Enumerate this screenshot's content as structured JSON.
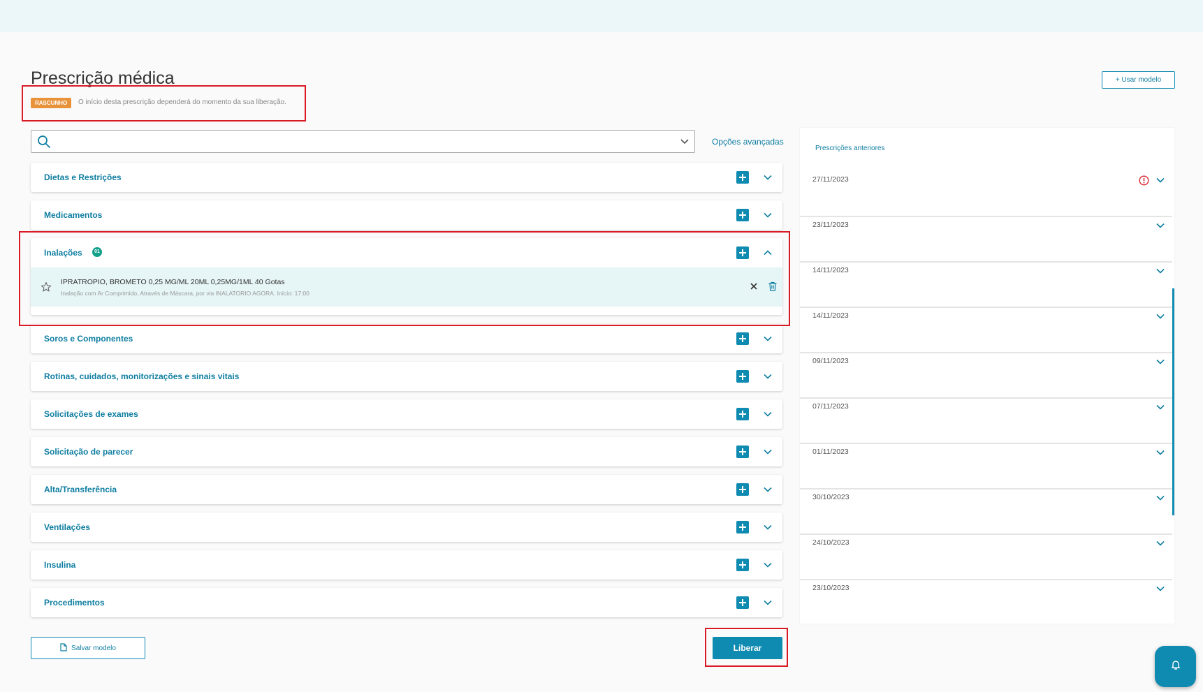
{
  "header": {
    "title": "Prescrição médica",
    "status_badge": "RASCUNHO",
    "status_message": "O início desta prescrição dependerá do momento da sua liberação.",
    "use_model_label": "+ Usar modelo"
  },
  "search": {
    "value": "",
    "placeholder": ""
  },
  "advanced_options_label": "Opções avançadas",
  "sections": [
    {
      "label": "Dietas e Restrições"
    },
    {
      "label": "Medicamentos"
    },
    {
      "label": "Inalações",
      "count": "01",
      "expanded": true,
      "items": [
        {
          "name": "IPRATROPIO, BROMETO 0,25 MG/ML 20ML 0,25MG/1ML 40 Gotas",
          "detail": "Inalação com Ar Comprimido, Através de Máscara, por via INALATORIO AGORA. Início: 17:00"
        }
      ]
    },
    {
      "label": "Soros e Componentes"
    },
    {
      "label": "Rotinas, cuidados, monitorizações e sinais vitais"
    },
    {
      "label": "Solicitações de exames"
    },
    {
      "label": "Solicitação de parecer"
    },
    {
      "label": "Alta/Transferência"
    },
    {
      "label": "Ventilações"
    },
    {
      "label": "Insulina"
    },
    {
      "label": "Procedimentos"
    }
  ],
  "footer": {
    "save_model_label": "Salvar modelo",
    "release_label": "Liberar"
  },
  "previous_prescriptions": {
    "title": "Prescrições anteriores",
    "items": [
      {
        "date": "27/11/2023",
        "alert": true
      },
      {
        "date": "23/11/2023"
      },
      {
        "date": "14/11/2023"
      },
      {
        "date": "14/11/2023"
      },
      {
        "date": "09/11/2023"
      },
      {
        "date": "07/11/2023"
      },
      {
        "date": "01/11/2023"
      },
      {
        "date": "30/10/2023"
      },
      {
        "date": "24/10/2023"
      },
      {
        "date": "23/10/2023"
      }
    ]
  },
  "icons": {
    "search": "search-icon",
    "chevron_down": "chevron-down-icon",
    "chevron_up": "chevron-up-icon",
    "plus": "plus-icon",
    "star": "star-icon",
    "close": "close-icon",
    "trash": "trash-icon",
    "alert": "alert-circle-icon",
    "document": "document-icon",
    "bell": "bell-icon"
  },
  "colors": {
    "accent": "#0f8ab0",
    "accent_text": "#0f7ea1",
    "draft_badge": "#e8923a",
    "count_badge": "#13a08a",
    "alert": "#d91b26",
    "expanded_row_bg": "#e6f5f6"
  }
}
